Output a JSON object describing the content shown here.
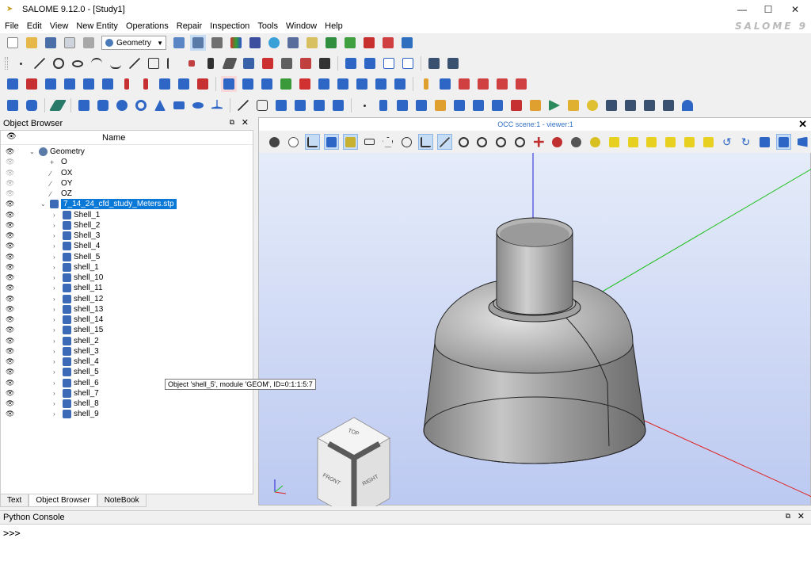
{
  "window": {
    "title": "SALOME 9.12.0 - [Study1]",
    "minimize": "—",
    "maximize": "☐",
    "close": "✕"
  },
  "brand_watermark": "SALOME 9",
  "menu": [
    "File",
    "Edit",
    "View",
    "New Entity",
    "Operations",
    "Repair",
    "Inspection",
    "Tools",
    "Window",
    "Help"
  ],
  "module_combo": {
    "value": "Geometry"
  },
  "object_browser": {
    "title": "Object Browser",
    "column_name": "Name",
    "items": [
      {
        "label": "Geometry",
        "level": 0,
        "expanded": true,
        "visible": true
      },
      {
        "label": "O",
        "level": 1,
        "visible": false
      },
      {
        "label": "OX",
        "level": 1,
        "visible": false
      },
      {
        "label": "OY",
        "level": 1,
        "visible": false
      },
      {
        "label": "OZ",
        "level": 1,
        "visible": false
      },
      {
        "label": "7_14_24_cfd_study_Meters.stp",
        "level": 1,
        "expanded": true,
        "selected": true,
        "visible": true
      },
      {
        "label": "Shell_1",
        "level": 2,
        "visible": true
      },
      {
        "label": "Shell_2",
        "level": 2,
        "visible": true
      },
      {
        "label": "Shell_3",
        "level": 2,
        "visible": true
      },
      {
        "label": "Shell_4",
        "level": 2,
        "visible": true
      },
      {
        "label": "Shell_5",
        "level": 2,
        "visible": true
      },
      {
        "label": "shell_1",
        "level": 2,
        "visible": true
      },
      {
        "label": "shell_10",
        "level": 2,
        "visible": true
      },
      {
        "label": "shell_11",
        "level": 2,
        "visible": true
      },
      {
        "label": "shell_12",
        "level": 2,
        "visible": true
      },
      {
        "label": "shell_13",
        "level": 2,
        "visible": true
      },
      {
        "label": "shell_14",
        "level": 2,
        "visible": true
      },
      {
        "label": "shell_15",
        "level": 2,
        "visible": true
      },
      {
        "label": "shell_2",
        "level": 2,
        "visible": true
      },
      {
        "label": "shell_3",
        "level": 2,
        "visible": true
      },
      {
        "label": "shell_4",
        "level": 2,
        "visible": true
      },
      {
        "label": "shell_5",
        "level": 2,
        "visible": true
      },
      {
        "label": "shell_6",
        "level": 2,
        "visible": true
      },
      {
        "label": "shell_7",
        "level": 2,
        "visible": true
      },
      {
        "label": "shell_8",
        "level": 2,
        "visible": true
      },
      {
        "label": "shell_9",
        "level": 2,
        "visible": true
      }
    ]
  },
  "tooltip": "Object 'shell_5', module 'GEOM', ID=0:1:1:5:7",
  "bottom_tabs": [
    "Text",
    "Object Browser",
    "NoteBook"
  ],
  "viewer": {
    "title": "OCC scene:1 - viewer:1",
    "cube_labels": {
      "top": "TOP",
      "front": "FRONT",
      "right": "RIGHT"
    },
    "axis_colors": {
      "x": "#e02020",
      "y": "#20c020",
      "z": "#2020d0"
    }
  },
  "console": {
    "title": "Python Console",
    "prompt": ">>>"
  }
}
